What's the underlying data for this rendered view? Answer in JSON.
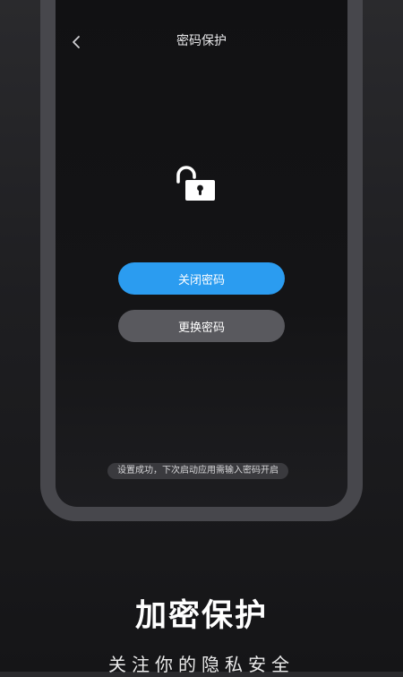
{
  "screen": {
    "title": "密码保护",
    "back_icon": "chevron-left-icon",
    "lock_icon": "unlocked-padlock-icon",
    "buttons": {
      "disable_password": "关闭密码",
      "change_password": "更换密码"
    },
    "toast": "设置成功，下次启动应用需输入密码开启"
  },
  "promo": {
    "title": "加密保护",
    "subtitle": "关注你的隐私安全"
  },
  "colors": {
    "primary_button": "#2b9cf0",
    "secondary_button": "#59595e",
    "phone_frame": "#47474c"
  }
}
